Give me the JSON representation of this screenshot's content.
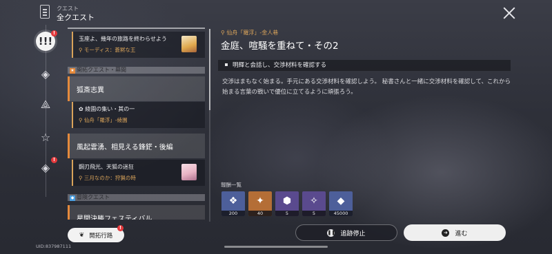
{
  "header": {
    "subtitle": "クエスト",
    "title": "全クエスト",
    "icon": "quest-book-icon"
  },
  "rail": {
    "items": [
      {
        "icon": "exclamation-icon",
        "glyph": "!!!",
        "active": true,
        "badge": "!"
      },
      {
        "icon": "trailblaze-diamond-icon",
        "glyph": "◈",
        "active": false
      },
      {
        "icon": "triangle-star-icon",
        "glyph": "⟁",
        "active": false
      },
      {
        "icon": "star-icon",
        "glyph": "☆",
        "active": false
      },
      {
        "icon": "adventure-diamond-icon",
        "glyph": "◈",
        "active": false,
        "badge": "!"
      }
    ]
  },
  "list": {
    "entries": [
      {
        "kind": "sub",
        "title": "玉座よ、幾年の旅路を終わらせよう",
        "loc": "モーディス：蒼黙な王"
      },
      {
        "kind": "section",
        "label": "開拓クエスト・幕間",
        "badge": "★",
        "color": "orange"
      },
      {
        "kind": "main",
        "title": "狐斎志異"
      },
      {
        "kind": "sub",
        "title": "綾園の集い・其の一",
        "loc": "仙舟「羅浮」-綾園",
        "icon": "flower-icon"
      },
      {
        "kind": "main",
        "title": "風起雲湧、相見える鋒鋩・後編"
      },
      {
        "kind": "sub",
        "title": "鋼刃飛光、天狐の迷狂",
        "loc": "三月なのか：狩猟の時"
      },
      {
        "kind": "section",
        "label": "冒険クエスト",
        "badge": "◆",
        "color": "blue"
      },
      {
        "kind": "main",
        "title": "星間決勝フェスティバル"
      }
    ]
  },
  "detail": {
    "location": "仙舟「羅浮」-金人巷",
    "title": "金庭、喧騒を重ねて・その2",
    "objective": "明輝と会話し、交渉材料を確認する",
    "description": "交渉はまもなく始まる。手元にある交渉材料を確認しよう。 秘書さんと一緒に交渉材料を確認して、これから始まる言葉の戦いで優位に立てるように頑張ろう。"
  },
  "rewards": {
    "label": "報酬一覧",
    "items": [
      {
        "icon": "trailblaze-exp-icon",
        "count": "200",
        "color": "#4d5f9a"
      },
      {
        "icon": "stellar-jade-icon",
        "count": "40",
        "color": "#b46e36"
      },
      {
        "icon": "material-purple-icon",
        "count": "5",
        "color": "#5a4a8e"
      },
      {
        "icon": "material-book-icon",
        "count": "5",
        "color": "#5a4a8e"
      },
      {
        "icon": "credit-icon",
        "count": "45000",
        "color": "#4d5f9a"
      }
    ]
  },
  "buttons": {
    "stop_track": "追跡停止",
    "proceed": "進む",
    "trailblaze": "開拓行路"
  },
  "footer": {
    "uid": "UID:837987111"
  }
}
